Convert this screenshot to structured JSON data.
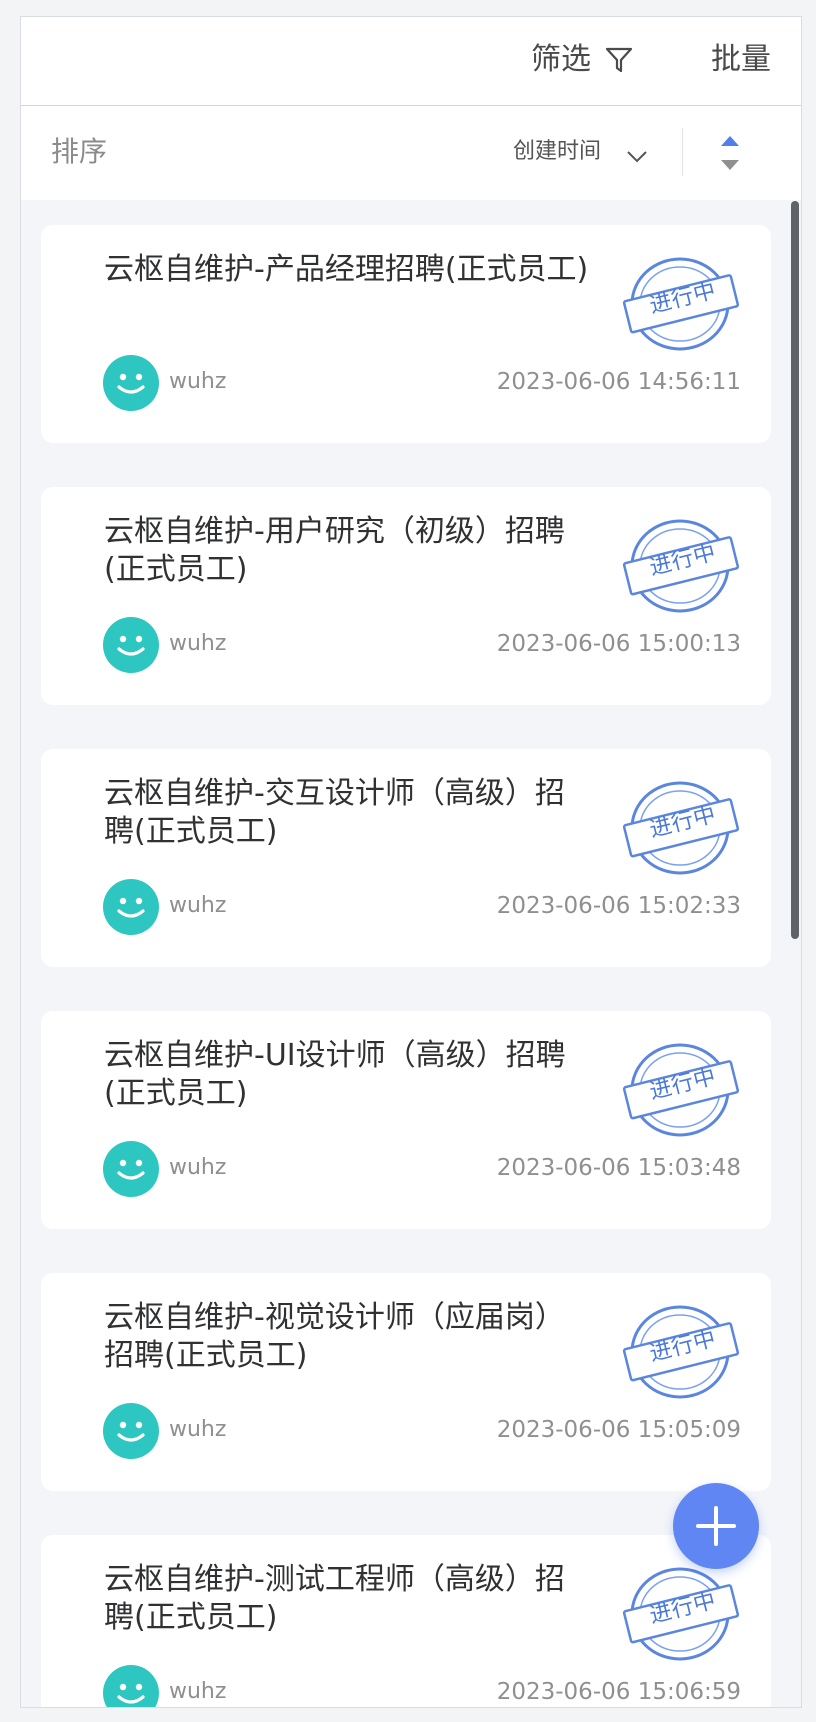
{
  "header": {
    "filter_label": "筛选",
    "batch_label": "批量"
  },
  "sort": {
    "label": "排序",
    "field_label": "创建时间"
  },
  "cards": [
    {
      "title": "云枢自维护-产品经理招聘(正式员工)",
      "user": "wuhz",
      "time": "2023-06-06 14:56:11",
      "status": "进行中"
    },
    {
      "title": "云枢自维护-用户研究（初级）招聘(正式员工)",
      "user": "wuhz",
      "time": "2023-06-06 15:00:13",
      "status": "进行中"
    },
    {
      "title": "云枢自维护-交互设计师（高级）招聘(正式员工)",
      "user": "wuhz",
      "time": "2023-06-06 15:02:33",
      "status": "进行中"
    },
    {
      "title": "云枢自维护-UI设计师（高级）招聘(正式员工)",
      "user": "wuhz",
      "time": "2023-06-06 15:03:48",
      "status": "进行中"
    },
    {
      "title": "云枢自维护-视觉设计师（应届岗）招聘(正式员工)",
      "user": "wuhz",
      "time": "2023-06-06 15:05:09",
      "status": "进行中"
    },
    {
      "title": "云枢自维护-测试工程师（高级）招聘(正式员工)",
      "user": "wuhz",
      "time": "2023-06-06 15:06:59",
      "status": "进行中"
    }
  ],
  "colors": {
    "accent": "#5f86f2",
    "avatar": "#2ec6c1",
    "stamp": "#4c79d9"
  },
  "icons": {
    "filter": "filter-icon",
    "sort_chevron": "chevron-down-icon",
    "sort_toggle": "sort-toggle-icon",
    "avatar": "smile-avatar-icon",
    "stamp": "status-stamp-icon",
    "add": "plus-icon"
  }
}
